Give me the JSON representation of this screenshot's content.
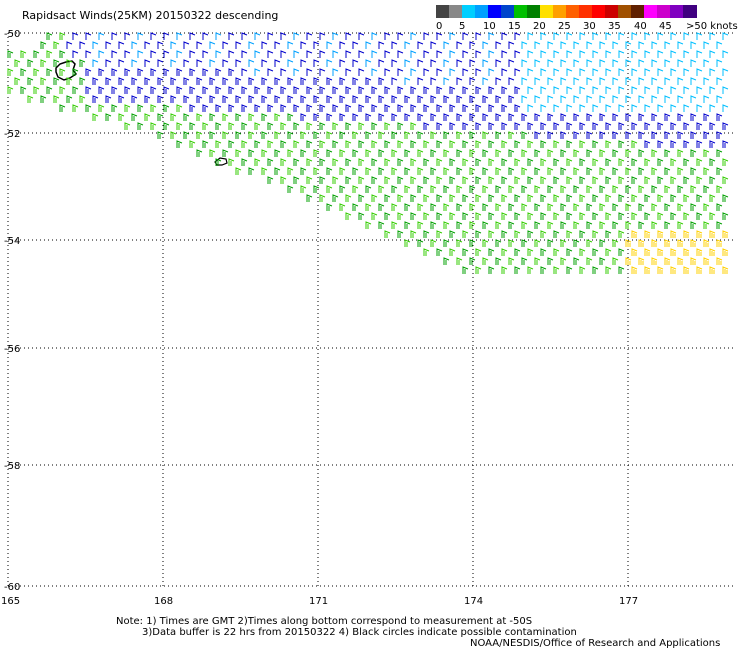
{
  "title": "Rapidsact Winds(25KM) 20150322 descending",
  "legend": {
    "colors": [
      "#444444",
      "#888888",
      "#00cfff",
      "#00a0ff",
      "#0000ff",
      "#0044cc",
      "#00c000",
      "#008000",
      "#ffe000",
      "#ffa000",
      "#ff6000",
      "#ff3000",
      "#ff0000",
      "#cc0000",
      "#a05000",
      "#602000",
      "#ff00ff",
      "#cc00cc",
      "#8000c0",
      "#400080"
    ],
    "labels": [
      "0",
      "5",
      "10",
      "15",
      "20",
      "25",
      "30",
      "35",
      "40",
      "45",
      ">50 knots"
    ]
  },
  "axes": {
    "lat_labels": [
      "-50",
      "-52",
      "-54",
      "-56",
      "-58",
      "-60"
    ],
    "lon_labels": [
      "165",
      "168",
      "171",
      "174",
      "177"
    ]
  },
  "notes": {
    "line1": "Note: 1) Times are GMT 2)Times along bottom correspond to measurement at -50S",
    "line2": "3)Data buffer is 22 hrs from 20150322 4) Black circles indicate possible contamination",
    "credit": "NOAA/NESDIS/Office of Research and Applications"
  }
}
